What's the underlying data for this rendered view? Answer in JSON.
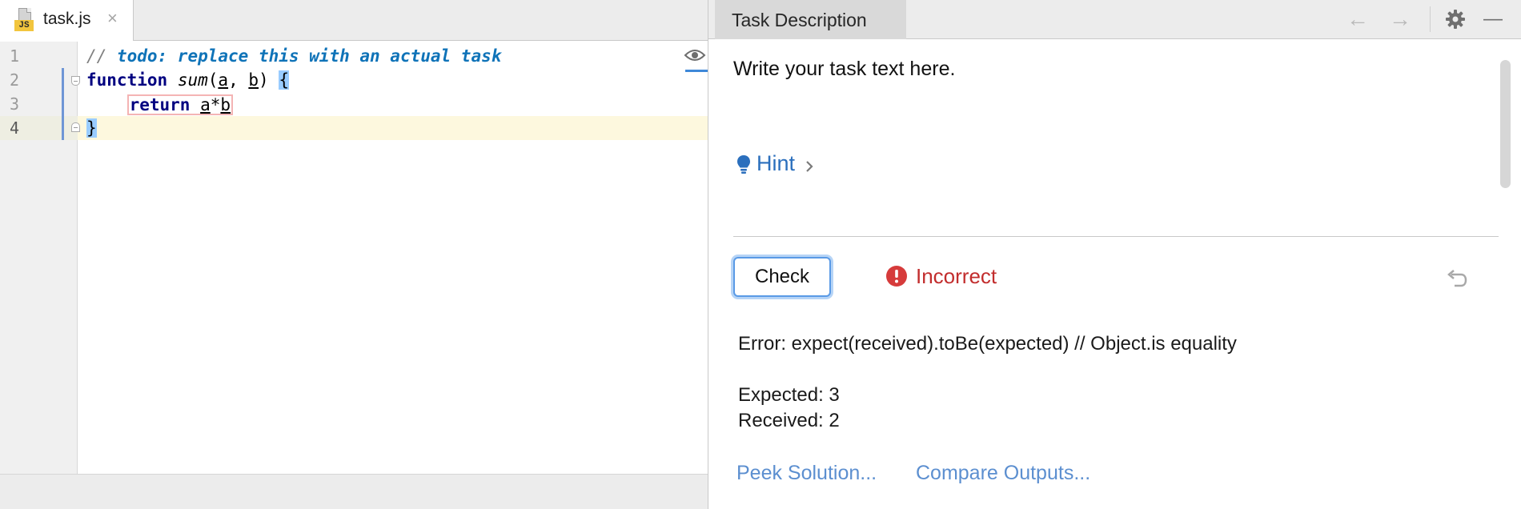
{
  "editor": {
    "tab": {
      "filename": "task.js",
      "badge": "JS",
      "close": "×"
    },
    "lines": [
      {
        "number": "1",
        "comment_slashes": "// ",
        "comment_todo": "todo: replace this with an actual task"
      },
      {
        "number": "2",
        "kw": "function",
        "name": "sum",
        "open_paren": "(",
        "p1": "a",
        "comma": ", ",
        "p2": "b",
        "close_paren": ") ",
        "brace": "{"
      },
      {
        "number": "3",
        "indent": "    ",
        "kw": "return",
        "sp": " ",
        "left": "a",
        "op": "*",
        "right": "b"
      },
      {
        "number": "4",
        "brace": "}"
      }
    ]
  },
  "task_panel": {
    "title": "Task Description",
    "task_text": "Write your task text here.",
    "hint_label": "Hint",
    "check_label": "Check",
    "status": "Incorrect",
    "error_lines": [
      "Error: expect(received).toBe(expected) // Object.is equality",
      "Expected: 3",
      "Received: 2"
    ],
    "links": {
      "peek": "Peek Solution...",
      "compare": "Compare Outputs..."
    },
    "header_buttons": {
      "back": "←",
      "forward": "→",
      "minimize": "—"
    }
  },
  "colors": {
    "accent": "#2b6fbd",
    "error": "#c22d2d",
    "current_line": "#fdf8de",
    "link": "#5c8fd0"
  },
  "icons": {
    "file": "js-file-icon",
    "close": "close-icon",
    "eye": "eye-icon",
    "hint": "lightbulb-icon",
    "chevron": "chevron-right-icon",
    "error": "error-icon",
    "reset": "undo-icon",
    "settings": "gear-icon"
  }
}
